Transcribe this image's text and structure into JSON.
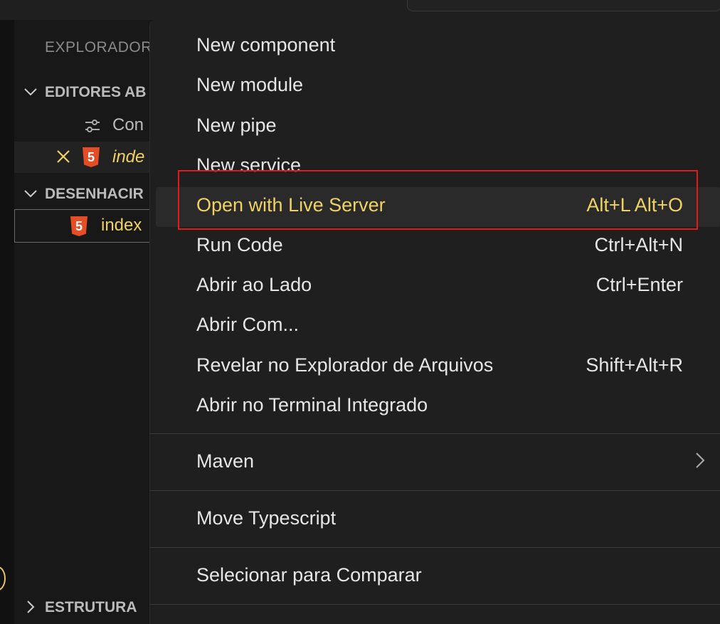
{
  "sidebar": {
    "title": "EXPLORADOR",
    "sections": [
      {
        "label": "EDITORES AB"
      },
      {
        "label": "DESENHACIR"
      },
      {
        "label": "ESTRUTURA"
      }
    ],
    "open_editors": [
      {
        "label": "Con",
        "icon": "settings-sliders-icon"
      },
      {
        "label": "inde",
        "icon": "html5-icon",
        "close": "close-icon"
      }
    ],
    "folder_file": {
      "label": "index",
      "icon": "html5-icon"
    }
  },
  "menu": {
    "items": [
      {
        "label": "New component",
        "shortcut": ""
      },
      {
        "label": "New module",
        "shortcut": ""
      },
      {
        "label": "New pipe",
        "shortcut": ""
      },
      {
        "label": "New service",
        "shortcut": ""
      },
      {
        "label": "Open with Live Server",
        "shortcut": "Alt+L Alt+O"
      },
      {
        "label": "Run Code",
        "shortcut": "Ctrl+Alt+N"
      },
      {
        "label": "Abrir ao Lado",
        "shortcut": "Ctrl+Enter"
      },
      {
        "label": "Abrir Com...",
        "shortcut": ""
      },
      {
        "label": "Revelar no Explorador de Arquivos",
        "shortcut": "Shift+Alt+R"
      },
      {
        "label": "Abrir no Terminal Integrado",
        "shortcut": ""
      },
      {
        "label": "Maven",
        "shortcut": ""
      },
      {
        "label": "Move Typescript",
        "shortcut": ""
      },
      {
        "label": "Selecionar para Comparar",
        "shortcut": ""
      }
    ]
  },
  "colors": {
    "highlight_text": "#f0d264",
    "annotation_box": "#e11b1b",
    "html5": "#e44d26"
  }
}
